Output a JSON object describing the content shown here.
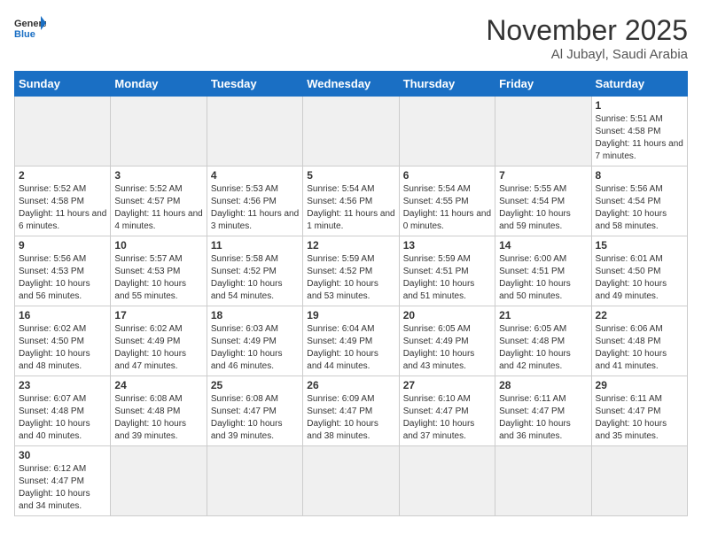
{
  "header": {
    "logo_general": "General",
    "logo_blue": "Blue",
    "month_title": "November 2025",
    "subtitle": "Al Jubayl, Saudi Arabia"
  },
  "weekdays": [
    "Sunday",
    "Monday",
    "Tuesday",
    "Wednesday",
    "Thursday",
    "Friday",
    "Saturday"
  ],
  "days": [
    {
      "day": "",
      "empty": true
    },
    {
      "day": "",
      "empty": true
    },
    {
      "day": "",
      "empty": true
    },
    {
      "day": "",
      "empty": true
    },
    {
      "day": "",
      "empty": true
    },
    {
      "day": "",
      "empty": true
    },
    {
      "day": "1",
      "sunrise": "5:51 AM",
      "sunset": "4:58 PM",
      "daylight": "11 hours and 7 minutes."
    },
    {
      "day": "2",
      "sunrise": "5:52 AM",
      "sunset": "4:58 PM",
      "daylight": "11 hours and 6 minutes."
    },
    {
      "day": "3",
      "sunrise": "5:52 AM",
      "sunset": "4:57 PM",
      "daylight": "11 hours and 4 minutes."
    },
    {
      "day": "4",
      "sunrise": "5:53 AM",
      "sunset": "4:56 PM",
      "daylight": "11 hours and 3 minutes."
    },
    {
      "day": "5",
      "sunrise": "5:54 AM",
      "sunset": "4:56 PM",
      "daylight": "11 hours and 1 minute."
    },
    {
      "day": "6",
      "sunrise": "5:54 AM",
      "sunset": "4:55 PM",
      "daylight": "11 hours and 0 minutes."
    },
    {
      "day": "7",
      "sunrise": "5:55 AM",
      "sunset": "4:54 PM",
      "daylight": "10 hours and 59 minutes."
    },
    {
      "day": "8",
      "sunrise": "5:56 AM",
      "sunset": "4:54 PM",
      "daylight": "10 hours and 58 minutes."
    },
    {
      "day": "9",
      "sunrise": "5:56 AM",
      "sunset": "4:53 PM",
      "daylight": "10 hours and 56 minutes."
    },
    {
      "day": "10",
      "sunrise": "5:57 AM",
      "sunset": "4:53 PM",
      "daylight": "10 hours and 55 minutes."
    },
    {
      "day": "11",
      "sunrise": "5:58 AM",
      "sunset": "4:52 PM",
      "daylight": "10 hours and 54 minutes."
    },
    {
      "day": "12",
      "sunrise": "5:59 AM",
      "sunset": "4:52 PM",
      "daylight": "10 hours and 53 minutes."
    },
    {
      "day": "13",
      "sunrise": "5:59 AM",
      "sunset": "4:51 PM",
      "daylight": "10 hours and 51 minutes."
    },
    {
      "day": "14",
      "sunrise": "6:00 AM",
      "sunset": "4:51 PM",
      "daylight": "10 hours and 50 minutes."
    },
    {
      "day": "15",
      "sunrise": "6:01 AM",
      "sunset": "4:50 PM",
      "daylight": "10 hours and 49 minutes."
    },
    {
      "day": "16",
      "sunrise": "6:02 AM",
      "sunset": "4:50 PM",
      "daylight": "10 hours and 48 minutes."
    },
    {
      "day": "17",
      "sunrise": "6:02 AM",
      "sunset": "4:49 PM",
      "daylight": "10 hours and 47 minutes."
    },
    {
      "day": "18",
      "sunrise": "6:03 AM",
      "sunset": "4:49 PM",
      "daylight": "10 hours and 46 minutes."
    },
    {
      "day": "19",
      "sunrise": "6:04 AM",
      "sunset": "4:49 PM",
      "daylight": "10 hours and 44 minutes."
    },
    {
      "day": "20",
      "sunrise": "6:05 AM",
      "sunset": "4:49 PM",
      "daylight": "10 hours and 43 minutes."
    },
    {
      "day": "21",
      "sunrise": "6:05 AM",
      "sunset": "4:48 PM",
      "daylight": "10 hours and 42 minutes."
    },
    {
      "day": "22",
      "sunrise": "6:06 AM",
      "sunset": "4:48 PM",
      "daylight": "10 hours and 41 minutes."
    },
    {
      "day": "23",
      "sunrise": "6:07 AM",
      "sunset": "4:48 PM",
      "daylight": "10 hours and 40 minutes."
    },
    {
      "day": "24",
      "sunrise": "6:08 AM",
      "sunset": "4:48 PM",
      "daylight": "10 hours and 39 minutes."
    },
    {
      "day": "25",
      "sunrise": "6:08 AM",
      "sunset": "4:47 PM",
      "daylight": "10 hours and 39 minutes."
    },
    {
      "day": "26",
      "sunrise": "6:09 AM",
      "sunset": "4:47 PM",
      "daylight": "10 hours and 38 minutes."
    },
    {
      "day": "27",
      "sunrise": "6:10 AM",
      "sunset": "4:47 PM",
      "daylight": "10 hours and 37 minutes."
    },
    {
      "day": "28",
      "sunrise": "6:11 AM",
      "sunset": "4:47 PM",
      "daylight": "10 hours and 36 minutes."
    },
    {
      "day": "29",
      "sunrise": "6:11 AM",
      "sunset": "4:47 PM",
      "daylight": "10 hours and 35 minutes."
    },
    {
      "day": "30",
      "sunrise": "6:12 AM",
      "sunset": "4:47 PM",
      "daylight": "10 hours and 34 minutes."
    },
    {
      "day": "",
      "empty": true
    },
    {
      "day": "",
      "empty": true
    },
    {
      "day": "",
      "empty": true
    },
    {
      "day": "",
      "empty": true
    },
    {
      "day": "",
      "empty": true
    }
  ],
  "labels": {
    "sunrise_prefix": "Sunrise: ",
    "sunset_prefix": "Sunset: ",
    "daylight_prefix": "Daylight: "
  }
}
